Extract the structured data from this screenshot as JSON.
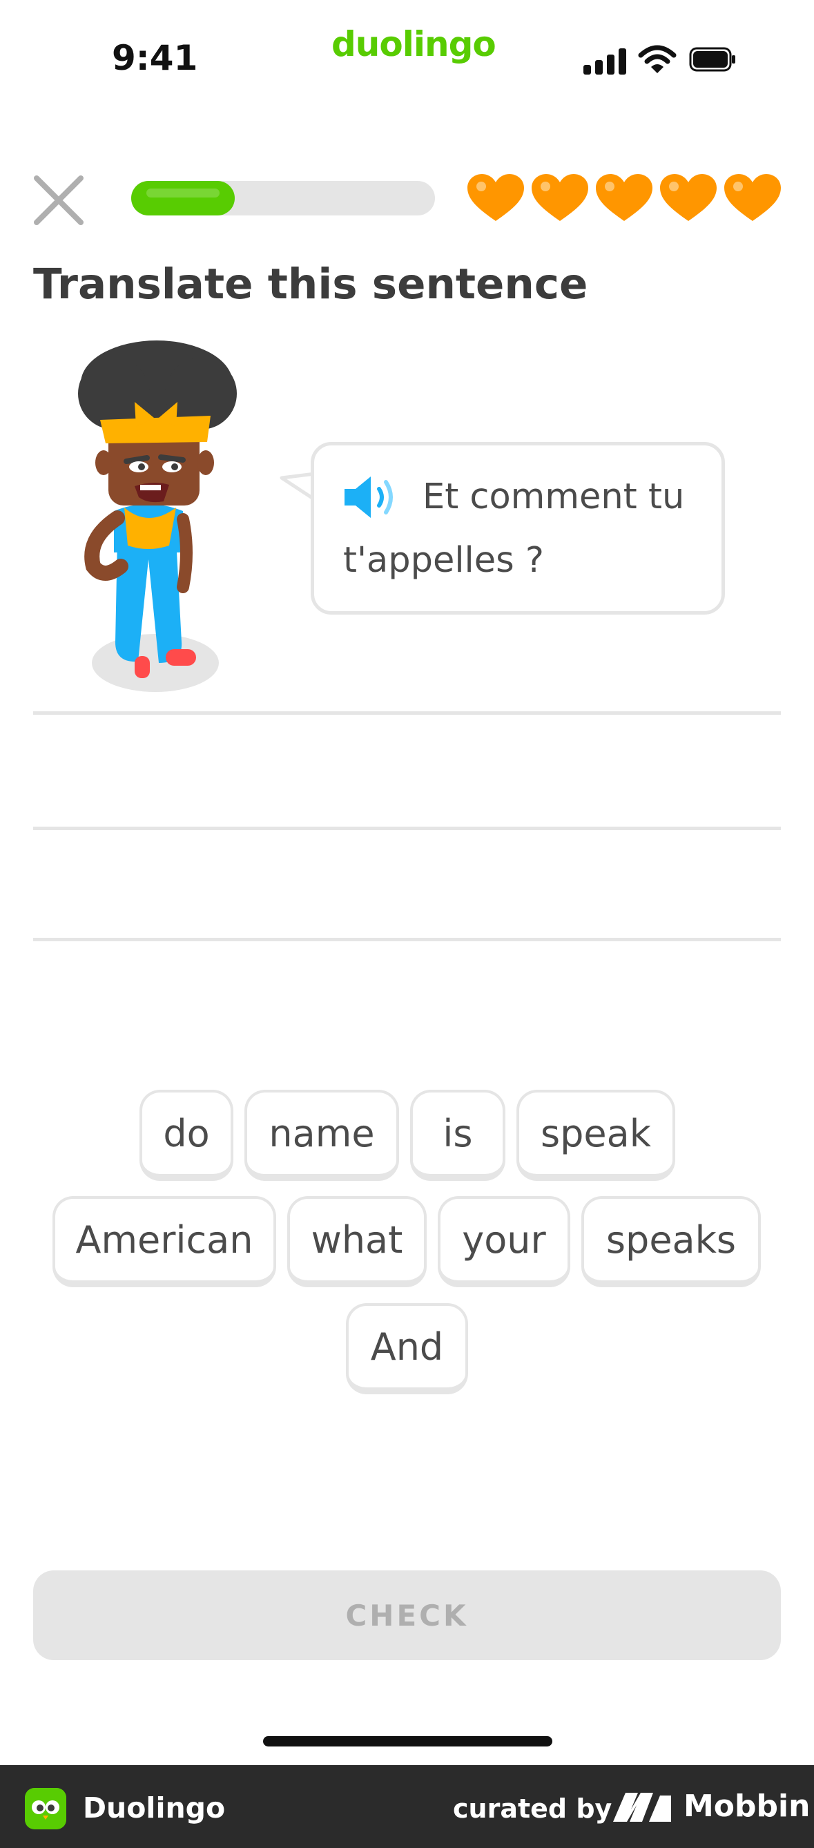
{
  "status_bar": {
    "time": "9:41",
    "app_logo": "duolingo"
  },
  "header": {
    "progress": 0.34,
    "hearts": 5
  },
  "prompt": {
    "title": "Translate this sentence"
  },
  "bubble": {
    "line1": "Et comment tu",
    "line2": "t'appelles ?",
    "icon": "speaker-icon"
  },
  "word_bank": [
    "do",
    "name",
    "is",
    "speak",
    "American",
    "what",
    "your",
    "speaks",
    "And"
  ],
  "check_button": {
    "label": "CHECK"
  },
  "footer": {
    "app_name": "Duolingo",
    "curated_by": "curated by",
    "brand": "Mobbin"
  },
  "colors": {
    "accent": "#58cc02",
    "heart": "#ff9600",
    "border": "#e5e5e5",
    "text": "#4b4b4b",
    "speaker": "#1cb0f6"
  }
}
